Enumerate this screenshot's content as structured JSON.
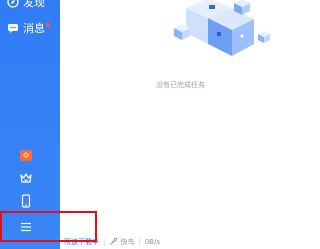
{
  "sidebar": {
    "cut_label": "发现",
    "messages_label": "消息"
  },
  "main": {
    "empty_text": "没有已完成任务"
  },
  "statusbar": {
    "mode_label": "限速下载中",
    "boost_label": "快鸟",
    "speed": "0B/s"
  },
  "colors": {
    "sidebar_blue": "#2f7cf6",
    "highlight_red": "#e0101c",
    "badge_red": "#ff4d5a"
  }
}
